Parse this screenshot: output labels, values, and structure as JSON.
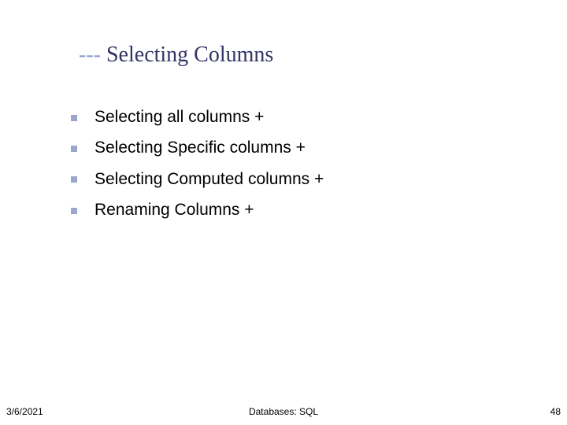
{
  "title": {
    "dashes": "---",
    "text": " Selecting Columns"
  },
  "bullets": [
    "Selecting all columns +",
    "Selecting Specific columns +",
    "Selecting Computed columns +",
    "Renaming Columns +"
  ],
  "footer": {
    "date": "3/6/2021",
    "center": "Databases: SQL",
    "page": "48"
  }
}
